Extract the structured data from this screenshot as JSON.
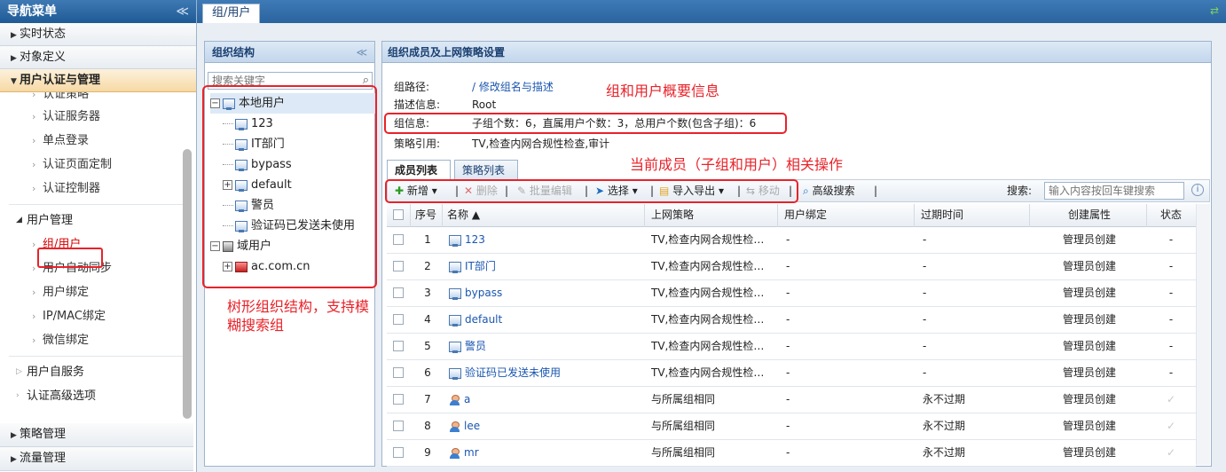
{
  "nav": {
    "title": "导航菜单",
    "collapse": "≪",
    "sections": [
      {
        "label": "实时状态"
      },
      {
        "label": "对象定义"
      },
      {
        "label": "用户认证与管理"
      }
    ],
    "clipped_item": "认证策略",
    "auth_items": [
      {
        "label": "认证服务器"
      },
      {
        "label": "单点登录"
      },
      {
        "label": "认证页面定制"
      },
      {
        "label": "认证控制器"
      }
    ],
    "user_mgmt_group": "用户管理",
    "user_items": [
      {
        "label": "组/用户"
      },
      {
        "label": "用户自动同步"
      },
      {
        "label": "用户绑定"
      },
      {
        "label": "IP/MAC绑定"
      },
      {
        "label": "微信绑定"
      }
    ],
    "self_service": "用户自服务",
    "auth_advanced": "认证高级选项",
    "bottom_sections": [
      {
        "label": "策略管理"
      },
      {
        "label": "流量管理"
      }
    ]
  },
  "tabbar": {
    "tab": "组/用户"
  },
  "org": {
    "title": "组织结构",
    "collapse": "≪",
    "search_placeholder": "搜索关键字",
    "tree": {
      "local": "本地用户",
      "children": [
        "123",
        "IT部门",
        "bypass",
        "default",
        "警员",
        "验证码已发送未使用"
      ],
      "domain": "域用户",
      "domain_child": "ac.com.cn"
    },
    "annotation": "树形组织结构，支持模糊搜索组"
  },
  "main": {
    "title": "组织成员及上网策略设置",
    "path_label": "组路径:",
    "path_value": "/ 修改组名与描述",
    "desc_label": "描述信息:",
    "desc_value": "Root",
    "group_info_label": "组信息:",
    "group_info_value": "子组个数：6，直属用户个数：3，总用户个数(包含子组)：6",
    "policy_label": "策略引用:",
    "policy_value": "TV,检查内网合规性检查,审计",
    "annotation_top": "组和用户概要信息",
    "annotation_mid": "当前成员（子组和用户）相关操作",
    "tabs": [
      "成员列表",
      "策略列表"
    ],
    "toolbar": {
      "add": "新增",
      "delete": "删除",
      "batch_edit": "批量编辑",
      "select": "选择",
      "import_export": "导入导出",
      "move": "移动",
      "adv_search": "高级搜索",
      "search_label": "搜索:",
      "search_placeholder": "输入内容按回车键搜索"
    },
    "columns": [
      "序号",
      "名称 ▲",
      "上网策略",
      "用户绑定",
      "过期时间",
      "创建属性",
      "状态"
    ],
    "rows": [
      {
        "no": "1",
        "type": "group",
        "name": "123",
        "policy": "TV,检查内网合规性检…",
        "bind": "-",
        "expire": "-",
        "created": "管理员创建",
        "status": "-"
      },
      {
        "no": "2",
        "type": "group",
        "name": "IT部门",
        "policy": "TV,检查内网合规性检…",
        "bind": "-",
        "expire": "-",
        "created": "管理员创建",
        "status": "-"
      },
      {
        "no": "3",
        "type": "group",
        "name": "bypass",
        "policy": "TV,检查内网合规性检…",
        "bind": "-",
        "expire": "-",
        "created": "管理员创建",
        "status": "-"
      },
      {
        "no": "4",
        "type": "group",
        "name": "default",
        "policy": "TV,检查内网合规性检…",
        "bind": "-",
        "expire": "-",
        "created": "管理员创建",
        "status": "-"
      },
      {
        "no": "5",
        "type": "group",
        "name": "警员",
        "policy": "TV,检查内网合规性检…",
        "bind": "-",
        "expire": "-",
        "created": "管理员创建",
        "status": "-"
      },
      {
        "no": "6",
        "type": "group",
        "name": "验证码已发送未使用",
        "policy": "TV,检查内网合规性检…",
        "bind": "-",
        "expire": "-",
        "created": "管理员创建",
        "status": "-"
      },
      {
        "no": "7",
        "type": "user",
        "name": "a",
        "policy": "与所属组相同",
        "bind": "-",
        "expire": "永不过期",
        "created": "管理员创建",
        "status": "✓"
      },
      {
        "no": "8",
        "type": "user",
        "name": "lee",
        "policy": "与所属组相同",
        "bind": "-",
        "expire": "永不过期",
        "created": "管理员创建",
        "status": "✓"
      },
      {
        "no": "9",
        "type": "user",
        "name": "mr",
        "policy": "与所属组相同",
        "bind": "-",
        "expire": "永不过期",
        "created": "管理员创建",
        "status": "✓"
      }
    ]
  }
}
